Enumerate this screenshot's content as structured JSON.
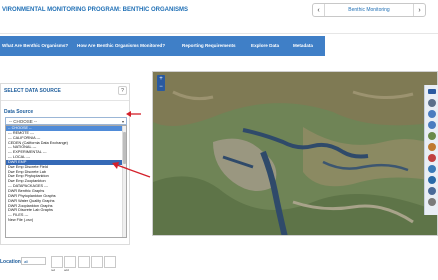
{
  "header": {
    "title": "VIRONMENTAL MONITORING PROGRAM: BENTHIC ORGANISMS",
    "pager_label": "Benthic Monitoring",
    "prev_glyph": "‹",
    "next_glyph": "›"
  },
  "nav": {
    "items": [
      "What Are Benthic Organisms?",
      "How Are Benthic Organisms Monitored?",
      "Reporting Requirements",
      "Explore Data",
      "Metadata"
    ]
  },
  "panel": {
    "title": "SELECT DATA SOURCE",
    "help": "?",
    "data_source_label": "Data Source",
    "select_value": "-- CHOOSE --",
    "options": [
      "-- CHOOSE --",
      "--- REMOTE ---",
      "--- CALIFORNIA ---",
      "CEDEN (California Data Exchange)",
      "--- NATIONAL ---",
      "--- EXPERIMENTAL ---",
      "--- LOCAL ---",
      "DWR EMP",
      "Dwr Emp Discrete Field",
      "Dwr Emp Discrete Lab",
      "Dwr Emp Phytoplankton",
      "Dwr Emp Zooplankton",
      "--- DATAPACKAGES ---",
      "DWR Benthic Graphs",
      "DWR Phytoplankton Graphs",
      "DWR Water Quality Graphs",
      "DWR Zooplankton Graphs",
      "DWR Discrete Lab Graphs",
      "--- FILES ---",
      "New File (.csv)"
    ],
    "highlighted_index": 7
  },
  "map": {
    "zoom_in": "+",
    "zoom_out": "−"
  },
  "bottom": {
    "location_label": "Location",
    "location_value": "all",
    "tool_labels": [
      "ted",
      "add",
      "remove",
      "",
      ""
    ]
  },
  "colors": {
    "nav_bg": "#3f7fc7",
    "title": "#1f6fb5",
    "highlight": "#3569b6",
    "arrow": "#d4202a"
  }
}
